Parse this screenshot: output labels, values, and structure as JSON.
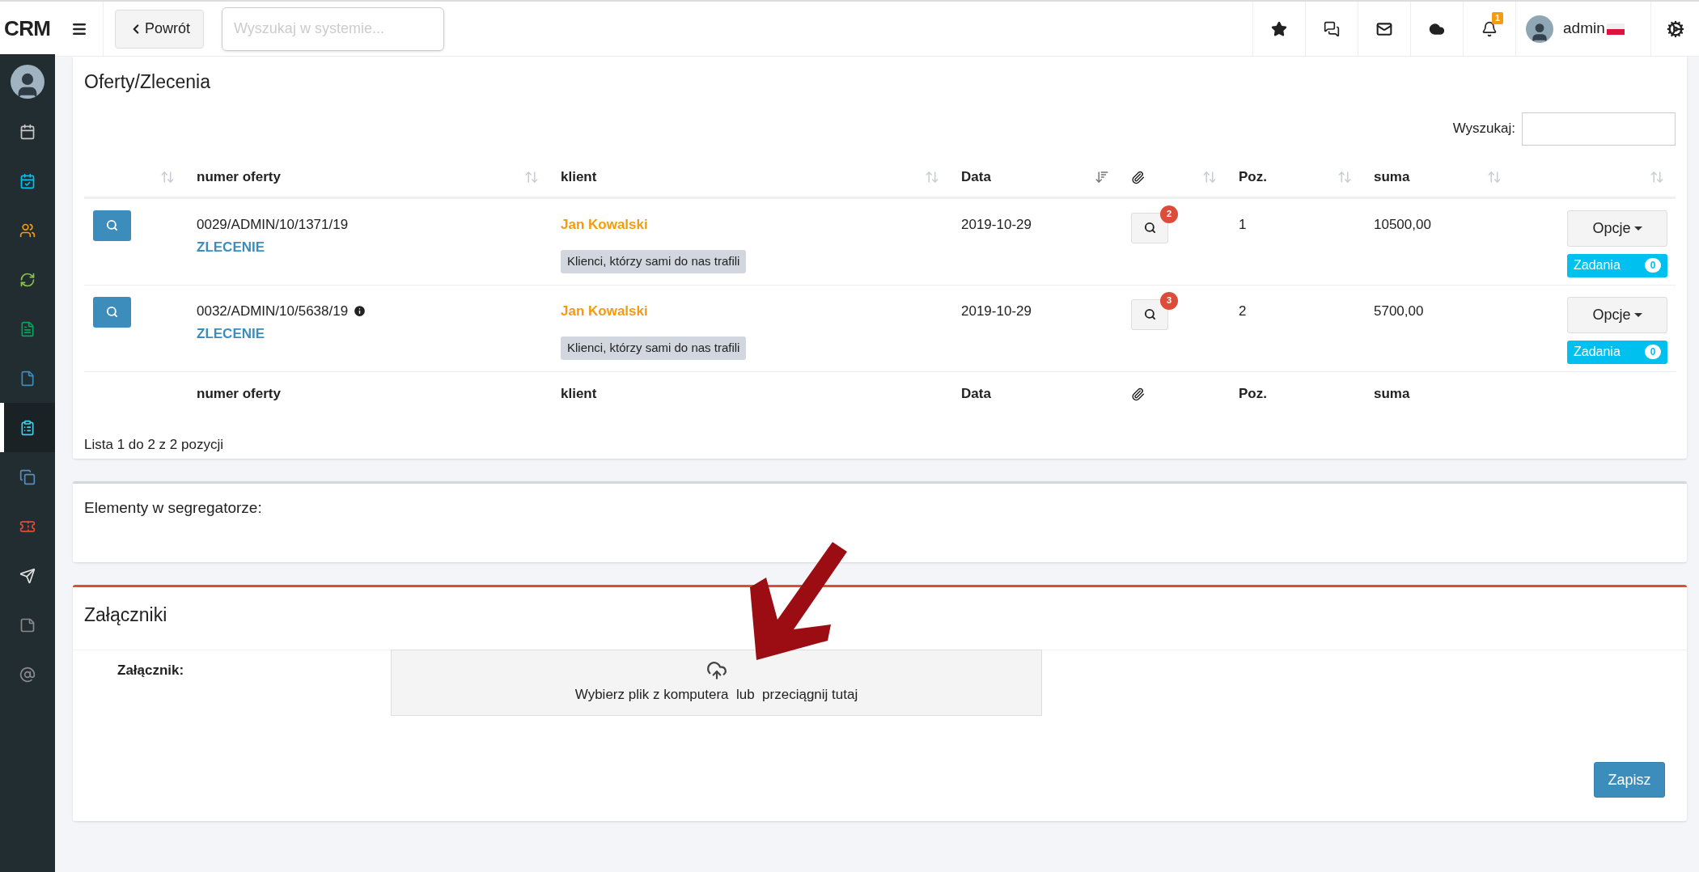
{
  "topbar": {
    "logo": "CRM",
    "back_button": "Powrót",
    "search": {
      "placeholder": "Wyszukaj w systemie..."
    },
    "notifications_badge": "1",
    "user": "admin"
  },
  "sidebar": {
    "items": [
      {
        "kind": "calendar",
        "color": "#c8c8c8",
        "selected": false
      },
      {
        "kind": "calendar-check",
        "color": "#00c0ef",
        "selected": false
      },
      {
        "kind": "users",
        "color": "#f39c12",
        "selected": false
      },
      {
        "kind": "refresh",
        "color": "#8bc34a",
        "selected": false
      },
      {
        "kind": "file-text",
        "color": "#00a65a",
        "selected": false
      },
      {
        "kind": "file-pdf",
        "color": "#3c8dbc",
        "selected": false
      },
      {
        "kind": "clipboard",
        "color": "#3fd0e6",
        "selected": true
      },
      {
        "kind": "copy",
        "color": "#5b8db8",
        "selected": false
      },
      {
        "kind": "ticket",
        "color": "#dd4b39",
        "selected": false
      },
      {
        "kind": "send",
        "color": "#e0e0e0",
        "selected": false
      },
      {
        "kind": "note",
        "color": "#8a8a8a",
        "selected": false
      },
      {
        "kind": "at",
        "color": "#8a8a8a",
        "selected": false
      }
    ]
  },
  "offers": {
    "title": "Oferty/Zlecenia",
    "search_label": "Wyszukaj:",
    "columns": [
      {
        "kind": "action",
        "sorted": false
      },
      {
        "kind": "text",
        "label": "numer oferty",
        "sorted": false
      },
      {
        "kind": "text",
        "label": "klient",
        "sorted": false
      },
      {
        "kind": "text",
        "label": "Data",
        "sorted": true
      },
      {
        "kind": "attachment",
        "sorted": false
      },
      {
        "kind": "text",
        "label": "Poz.",
        "sorted": false
      },
      {
        "kind": "text",
        "label": "suma",
        "sorted": false
      },
      {
        "kind": "options",
        "sorted": false
      }
    ],
    "rows": [
      {
        "number": "0029/ADMIN/10/1371/19",
        "info": false,
        "type": "ZLECENIE",
        "client": "Jan Kowalski",
        "tag": "Klienci, którzy sami do nas trafili",
        "date": "2019-10-29",
        "attachments": "2",
        "positions": "1",
        "sum": "10500,00",
        "options": "Opcje",
        "tasks": "Zadania",
        "tasks_count": "0"
      },
      {
        "number": "0032/ADMIN/10/5638/19",
        "info": true,
        "type": "ZLECENIE",
        "client": "Jan Kowalski",
        "tag": "Klienci, którzy sami do nas trafili",
        "date": "2019-10-29",
        "attachments": "3",
        "positions": "2",
        "sum": "5700,00",
        "options": "Opcje",
        "tasks": "Zadania",
        "tasks_count": "0"
      }
    ],
    "footer": [
      "numer oferty",
      "klient",
      "Data",
      "Poz.",
      "suma"
    ],
    "info": "Lista 1 do 2 z 2 pozycji"
  },
  "binder": {
    "title": "Elementy w segregatorze:"
  },
  "attachments": {
    "title": "Załączniki",
    "field_label": "Załącznik:",
    "dropzone": "Wybierz plik z komputera  lub  przeciągnij tutaj",
    "save_button": "Zapisz"
  }
}
